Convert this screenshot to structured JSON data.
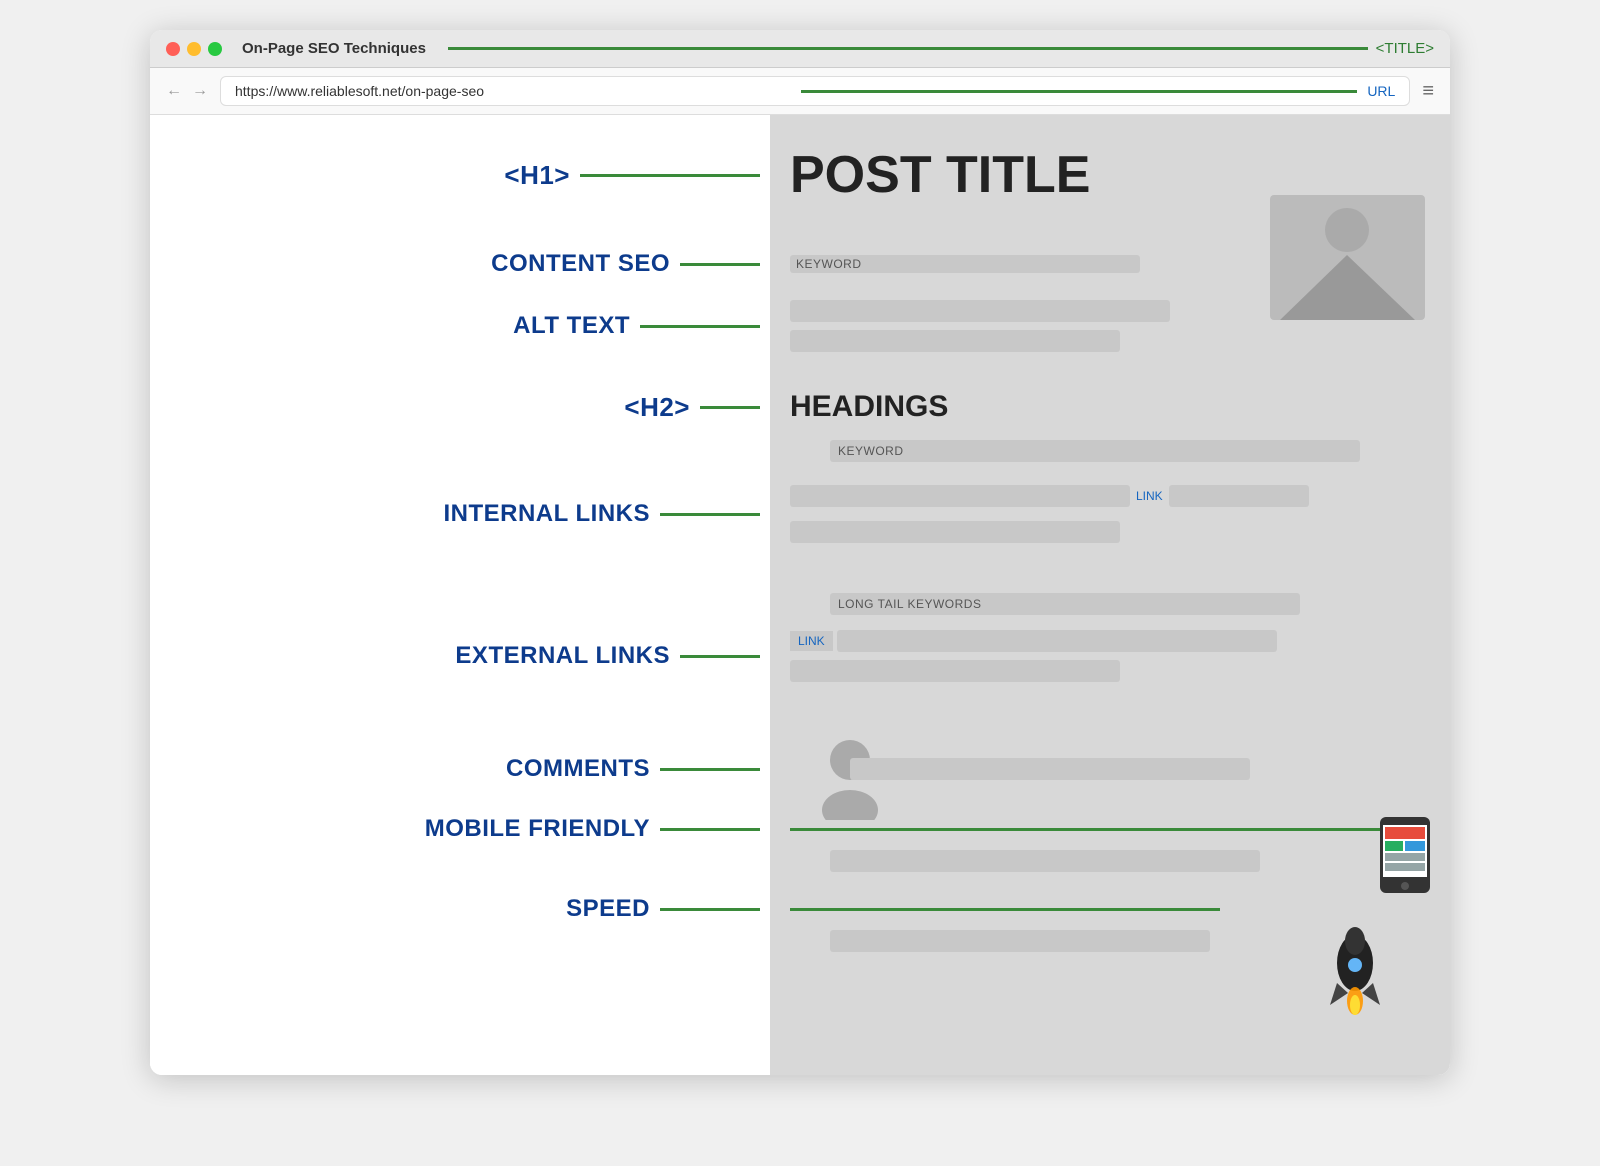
{
  "browser": {
    "title": "On-Page SEO Techniques",
    "title_tag": "<TITLE>",
    "url": "https://www.reliablesoft.net/on-page-seo",
    "url_label": "URL",
    "menu_icon": "≡"
  },
  "diagram": {
    "h1_tag": "<H1>",
    "post_title": "POST TITLE",
    "h2_tag": "<H2>",
    "headings": "HEADINGS",
    "labels": {
      "content_seo": "CONTENT SEO",
      "alt_text": "ALT TEXT",
      "h2": "<H2>",
      "internal_links": "INTERNAL LINKS",
      "external_links": "EXTERNAL LINKS",
      "comments": "COMMENTS",
      "mobile_friendly": "MOBILE FRIENDLY",
      "speed": "SPEED"
    },
    "content": {
      "keyword": "KEYWORD",
      "keyword2": "KEYWORD",
      "link": "LINK",
      "link2": "LINK",
      "long_tail": "LONG TAIL KEYWORDS"
    }
  }
}
